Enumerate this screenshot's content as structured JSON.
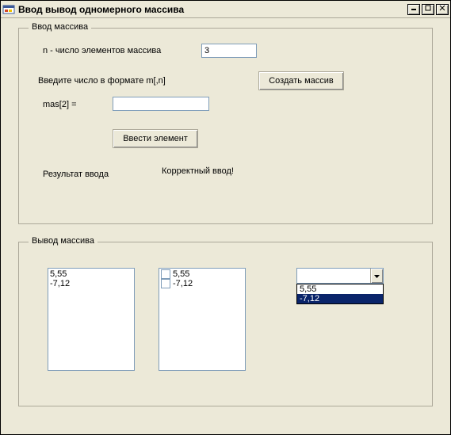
{
  "window": {
    "title": "Ввод вывод одномерного массива"
  },
  "input_group": {
    "legend": "Ввод массива",
    "n_label": "n - число элементов массива",
    "n_value": "3",
    "format_label": "Введите число в формате m[,n]",
    "create_btn": "Создать массив",
    "index_label": "mas[2] =",
    "element_value": "",
    "enter_btn": "Ввести элемент",
    "result_label": "Результат ввода",
    "result_value": "Корректный ввод!"
  },
  "output_group": {
    "legend": "Вывод массива",
    "list_items": [
      "5,55",
      "-7,12"
    ],
    "check_items": [
      "5,55",
      "-7,12"
    ],
    "combo": {
      "value": "",
      "options": [
        "5,55",
        "-7,12"
      ],
      "selected_index": 1
    }
  }
}
